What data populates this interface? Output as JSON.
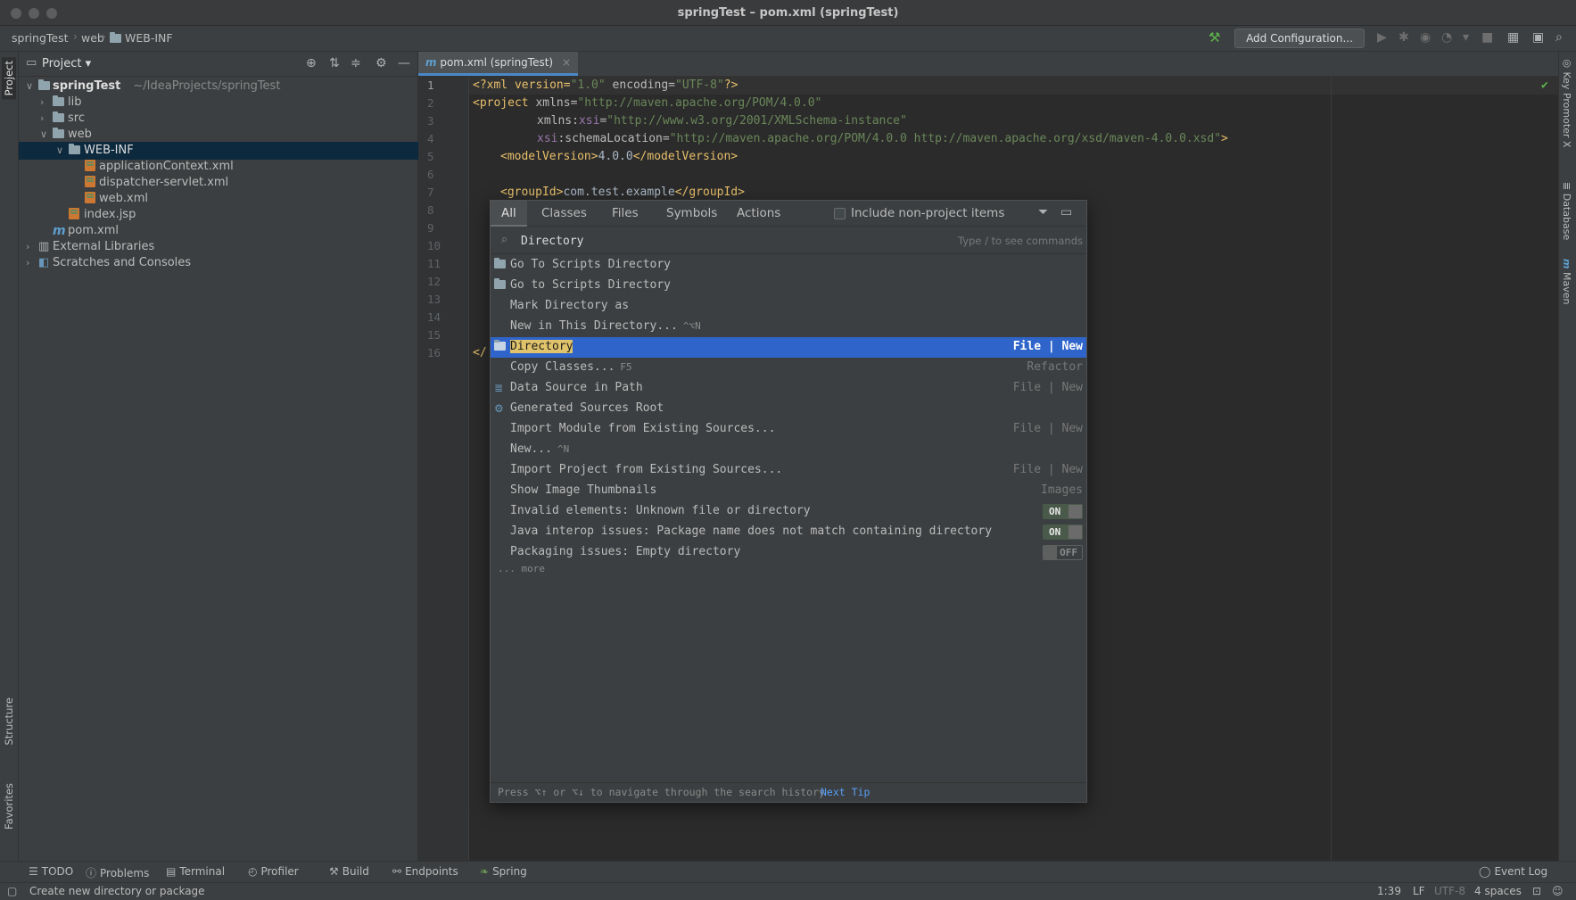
{
  "window": {
    "title": "springTest – pom.xml (springTest)"
  },
  "breadcrumb": {
    "root": "springTest",
    "web": "web",
    "webinf": "WEB-INF"
  },
  "toolbar": {
    "add_configuration": "Add Configuration..."
  },
  "left_tabs": {
    "project": "Project",
    "structure": "Structure",
    "favorites": "Favorites"
  },
  "right_tabs": {
    "key_promoter": "Key Promoter X",
    "database": "Database",
    "maven": "Maven"
  },
  "project_panel": {
    "title": "Project",
    "tree": [
      {
        "label": "springTest",
        "path": "~/IdeaProjects/springTest"
      },
      {
        "label": "lib"
      },
      {
        "label": "src"
      },
      {
        "label": "web"
      },
      {
        "label": "WEB-INF"
      },
      {
        "label": "applicationContext.xml"
      },
      {
        "label": "dispatcher-servlet.xml"
      },
      {
        "label": "web.xml"
      },
      {
        "label": "index.jsp"
      },
      {
        "label": "pom.xml"
      },
      {
        "label": "External Libraries"
      },
      {
        "label": "Scratches and Consoles"
      }
    ]
  },
  "editor": {
    "tab": "pom.xml (springTest)",
    "line_numbers": [
      "1",
      "2",
      "3",
      "4",
      "5",
      "6",
      "7",
      "8",
      "9",
      "10",
      "11",
      "12",
      "13",
      "14",
      "15",
      "16"
    ],
    "lines": {
      "l1": {
        "a": "<?xml version=",
        "b": "\"1.0\"",
        "c": " encoding=",
        "d": "\"UTF-8\"",
        "e": "?>"
      },
      "l2": {
        "a": "<project ",
        "b": "xmlns=",
        "c": "\"http://maven.apache.org/POM/4.0.0\""
      },
      "l3": {
        "a": "xmlns:",
        "b": "xsi",
        "c": "=",
        "d": "\"http://www.w3.org/2001/XMLSchema-instance\""
      },
      "l4": {
        "a": "xsi",
        "b": ":schemaLocation=",
        "c": "\"http://maven.apache.org/POM/4.0.0 http://maven.apache.org/xsd/maven-4.0.0.xsd\"",
        "d": ">"
      },
      "l5": {
        "a": "<modelVersion>",
        "b": "4.0.0",
        "c": "</modelVersion>"
      },
      "l7": {
        "a": "<groupId>",
        "b": "com.test.example",
        "c": "</groupId>"
      },
      "l16": {
        "a": "</"
      }
    }
  },
  "search_popup": {
    "tabs": [
      "All",
      "Classes",
      "Files",
      "Symbols",
      "Actions"
    ],
    "include_non_project": "Include non-project items",
    "query": "Directory",
    "hint": "Type / to see commands",
    "results": [
      {
        "label": "Go To Scripts Directory",
        "right": ""
      },
      {
        "label": "Go to Scripts Directory",
        "right": ""
      },
      {
        "label": "Mark Directory as",
        "right": ""
      },
      {
        "label": "New in This Directory...",
        "shortcut": "^⌥N",
        "right": ""
      },
      {
        "label": "Directory",
        "right": "File | New"
      },
      {
        "label": "Copy Classes...",
        "shortcut": "F5",
        "right": "Refactor"
      },
      {
        "label": "Data Source in Path",
        "right": "File | New"
      },
      {
        "label": "Generated Sources Root",
        "right": ""
      },
      {
        "label": "Import Module from Existing Sources...",
        "right": "File | New"
      },
      {
        "label": "New...",
        "shortcut": "^N",
        "right": ""
      },
      {
        "label": "Import Project from Existing Sources...",
        "right": "File | New"
      },
      {
        "label": "Show Image Thumbnails",
        "right": "Images"
      },
      {
        "label": "Invalid elements: Unknown file or directory",
        "toggle": "ON"
      },
      {
        "label": "Java interop issues: Package name does not match containing directory",
        "toggle": "ON"
      },
      {
        "label": "Packaging issues: Empty directory",
        "toggle": "OFF"
      }
    ],
    "more": "... more",
    "footer": "Press ⌥↑ or ⌥↓ to navigate through the search history",
    "next_tip": "Next Tip"
  },
  "bottom_tools": [
    "TODO",
    "Problems",
    "Terminal",
    "Profiler",
    "Build",
    "Endpoints",
    "Spring"
  ],
  "event_log": "Event Log",
  "status": {
    "message": "Create new directory or package",
    "position": "1:39",
    "line_sep": "LF",
    "encoding": "UTF-8",
    "indent": "4 spaces"
  }
}
